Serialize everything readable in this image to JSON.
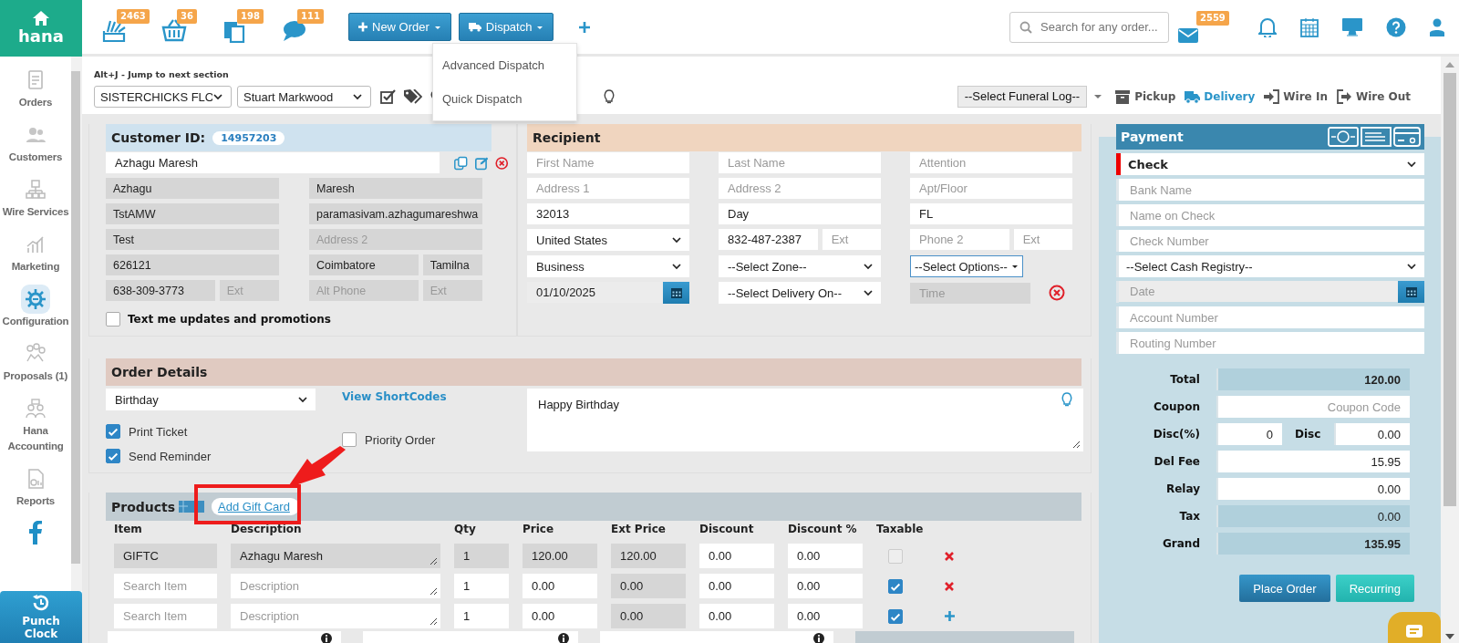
{
  "sidebar": {
    "brand": "hana",
    "items": [
      {
        "label": "Orders",
        "selected": false
      },
      {
        "label": "Customers",
        "selected": false
      },
      {
        "label": "Wire Services",
        "selected": false
      },
      {
        "label": "Marketing",
        "selected": false
      },
      {
        "label": "Configuration",
        "selected": true
      },
      {
        "label": "Proposals (1)",
        "selected": false
      },
      {
        "label": "Hana Accounting",
        "selected": false
      },
      {
        "label": "Reports",
        "selected": false
      }
    ],
    "punch_clock": "Punch Clock"
  },
  "topbar": {
    "counters": [
      {
        "count": "2463"
      },
      {
        "count": "36"
      },
      {
        "count": "198"
      },
      {
        "count": "111"
      }
    ],
    "buttons": [
      {
        "label": "New Order",
        "kind": "new"
      },
      {
        "label": "Dispatch",
        "kind": "dispatch"
      }
    ],
    "search": {
      "placeholder": "Search for any order..."
    },
    "mail_count": "2559"
  },
  "dispatch_menu": {
    "items": [
      "Advanced Dispatch",
      "Quick Dispatch"
    ]
  },
  "subbar": {
    "hint": "Alt+J - Jump to next section",
    "shop": "SISTERCHICKS FLO",
    "staff": "Stuart Markwood",
    "funeral_log": "--Select Funeral Log--",
    "order_types": [
      {
        "label": "Pickup",
        "selected": false
      },
      {
        "label": "Delivery",
        "selected": true
      },
      {
        "label": "Wire In",
        "selected": false
      },
      {
        "label": "Wire Out",
        "selected": false
      }
    ]
  },
  "customer": {
    "title": "Customer ID:",
    "id": "14957203",
    "name": "Azhagu Maresh",
    "rows": [
      {
        "left": [
          {
            "value": "Azhagu",
            "readonly": true
          }
        ],
        "right": [
          {
            "value": "Maresh",
            "readonly": true
          }
        ]
      },
      {
        "left": [
          {
            "value": "TstAMW",
            "readonly": true
          }
        ],
        "right": [
          {
            "value": "paramasivam.azhagumareshwa",
            "readonly": true
          }
        ]
      },
      {
        "left": [
          {
            "value": "Test",
            "readonly": true
          }
        ],
        "right": [
          {
            "placeholder": "Address 2",
            "readonly": true
          }
        ]
      },
      {
        "left": [
          {
            "value": "626121",
            "readonly": true
          }
        ],
        "right": [
          {
            "value": "Coimbatore",
            "readonly": true
          },
          {
            "value": "Tamilna",
            "readonly": true
          }
        ]
      },
      {
        "left": [
          {
            "value": "638-309-3773",
            "readonly": true
          },
          {
            "placeholder": "Ext",
            "readonly": true
          }
        ],
        "right": [
          {
            "placeholder": "Alt Phone",
            "readonly": true
          },
          {
            "placeholder": "Ext",
            "readonly": true
          }
        ]
      }
    ],
    "sms_optin": {
      "label": "Text me updates and promotions",
      "checked": false
    }
  },
  "recipient": {
    "title": "Recipient",
    "rows": [
      [
        [
          {
            "placeholder": "First Name"
          }
        ],
        [
          {
            "placeholder": "Last Name"
          }
        ],
        [
          {
            "placeholder": "Attention"
          }
        ]
      ],
      [
        [
          {
            "placeholder": "Address 1"
          }
        ],
        [
          {
            "placeholder": "Address 2"
          }
        ],
        [
          {
            "placeholder": "Apt/Floor"
          }
        ]
      ],
      [
        [
          {
            "value": "32013"
          }
        ],
        [
          {
            "value": "Day"
          }
        ],
        [
          {
            "value": "FL"
          }
        ]
      ],
      [
        [
          {
            "kind": "select",
            "value": "United States"
          }
        ],
        [
          {
            "value": "832-487-2387"
          },
          {
            "placeholder": "Ext"
          }
        ],
        [
          {
            "placeholder": "Phone 2"
          },
          {
            "placeholder": "Ext"
          }
        ]
      ],
      [
        [
          {
            "kind": "select",
            "value": "Business"
          }
        ],
        [
          {
            "kind": "select",
            "value": "--Select Zone--"
          }
        ],
        [
          {
            "kind": "dropdown",
            "value": "--Select Options--"
          }
        ]
      ],
      [
        [
          {
            "kind": "date",
            "value": "01/10/2025",
            "readonly": true
          }
        ],
        [
          {
            "kind": "select",
            "value": "--Select Delivery On--"
          }
        ],
        [
          {
            "placeholder": "Time",
            "readonly": true
          },
          {
            "kind": "clear"
          }
        ]
      ]
    ]
  },
  "order_details": {
    "title": "Order Details",
    "occasion": "Birthday",
    "shortcodes_link": "View ShortCodes",
    "options": [
      {
        "label": "Print Ticket",
        "checked": true
      },
      {
        "label": "Send Reminder",
        "checked": true
      },
      {
        "label": "Priority Order",
        "checked": false
      }
    ],
    "message": "Happy Birthday"
  },
  "products": {
    "title": "Products",
    "add_gift_card": "Add Gift Card",
    "columns": [
      "Item",
      "Description",
      "Qty",
      "Price",
      "Ext Price",
      "Discount",
      "Discount %",
      "Taxable"
    ],
    "rows": [
      {
        "cells": [
          {
            "value": "GIFTC",
            "readonly": true
          },
          {
            "kind": "textarea",
            "value": "Azhagu Maresh",
            "readonly": true
          },
          {
            "value": "1",
            "readonly": true
          },
          {
            "value": "120.00",
            "readonly": true
          },
          {
            "value": "120.00",
            "readonly": true
          },
          {
            "value": "0.00"
          },
          {
            "value": "0.00"
          }
        ],
        "taxable": {
          "checked": false,
          "disabled": true
        },
        "kind": "remove"
      },
      {
        "cells": [
          {
            "placeholder": "Search Item"
          },
          {
            "kind": "textarea",
            "placeholder": "Description"
          },
          {
            "value": "1"
          },
          {
            "value": "0.00"
          },
          {
            "value": "0.00",
            "readonly": true
          },
          {
            "value": "0.00"
          },
          {
            "value": "0.00"
          }
        ],
        "taxable": {
          "checked": true,
          "disabled": false
        },
        "kind": "remove"
      },
      {
        "cells": [
          {
            "placeholder": "Search Item"
          },
          {
            "kind": "textarea",
            "placeholder": "Description"
          },
          {
            "value": "1"
          },
          {
            "value": "0.00"
          },
          {
            "value": "0.00",
            "readonly": true
          },
          {
            "value": "0.00"
          },
          {
            "value": "0.00"
          }
        ],
        "taxable": {
          "checked": true,
          "disabled": false
        },
        "kind": "add"
      }
    ]
  },
  "payment": {
    "title": "Payment",
    "method": "Check",
    "fields": [
      {
        "placeholder": "Bank Name"
      },
      {
        "placeholder": "Name on Check"
      },
      {
        "placeholder": "Check Number"
      },
      {
        "kind": "select",
        "value": "--Select Cash Registry--"
      },
      {
        "kind": "date",
        "placeholder": "Date",
        "readonly": true
      },
      {
        "placeholder": "Account Number"
      },
      {
        "placeholder": "Routing Number"
      }
    ],
    "totals": [
      {
        "label": "Total",
        "fields": [
          {
            "kind": "total",
            "value": "120.00",
            "readonly": true
          }
        ]
      },
      {
        "label": "Coupon",
        "fields": [
          {
            "placeholder": "Coupon Code"
          }
        ]
      },
      {
        "label": "Disc(%)",
        "fields": [
          {
            "value": "0"
          },
          {
            "kind": "label",
            "value": "Disc"
          },
          {
            "value": "0.00"
          }
        ]
      },
      {
        "label": "Del Fee",
        "fields": [
          {
            "value": "15.95"
          }
        ]
      },
      {
        "label": "Relay",
        "fields": [
          {
            "value": "0.00"
          }
        ]
      },
      {
        "label": "Tax",
        "fields": [
          {
            "value": "0.00",
            "readonly": true
          }
        ]
      },
      {
        "label": "Grand",
        "fields": [
          {
            "kind": "total",
            "value": "135.95",
            "readonly": true
          }
        ]
      }
    ],
    "buttons": [
      {
        "label": "Place Order",
        "kind": "primary"
      },
      {
        "label": "Recurring",
        "kind": "secondary"
      }
    ]
  }
}
